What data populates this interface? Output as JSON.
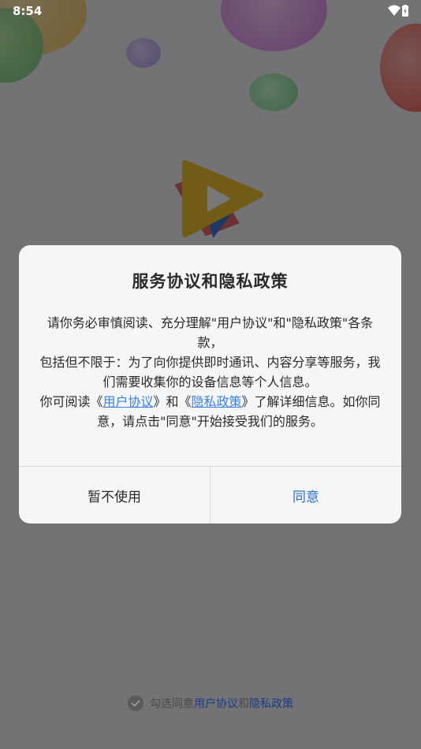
{
  "status": {
    "time": "8:54"
  },
  "dialog": {
    "title": "服务协议和隐私政策",
    "para1": "请你务必审慎阅读、充分理解\"用户协议\"和\"隐私政策\"各条款，",
    "para2": "包括但不限于：为了向你提供即时通讯、内容分享等服务，我们需要收集你的设备信息等个人信息。",
    "para3_prefix": "你可阅读《",
    "user_agreement": "用户协议",
    "para3_mid": "》和《",
    "privacy_policy": "隐私政策",
    "para3_suffix": "》了解详细信息。如你同意，请点击\"同意\"开始接受我们的服务。",
    "cancel_label": "暂不使用",
    "agree_label": "同意"
  },
  "bottom": {
    "prefix": "勾选同意",
    "user_agreement": "用户协议",
    "and": "和",
    "privacy_policy": "隐私政策"
  },
  "colors": {
    "link": "#3b7fe0",
    "agree": "#2f6ec9",
    "overlay": "rgba(0,0,0,0.53)"
  }
}
